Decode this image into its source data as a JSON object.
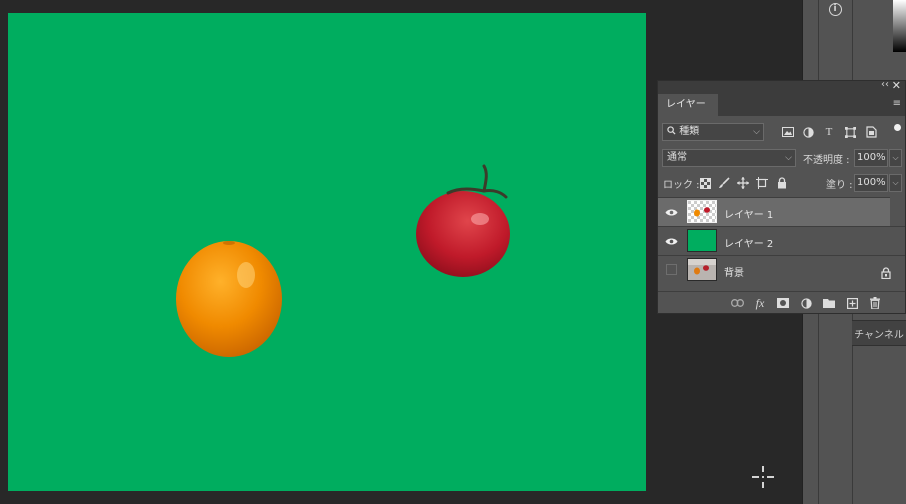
{
  "app": {
    "colors": {
      "canvas_bg": "#00ad5f",
      "workspace_bg": "#282828",
      "panel_bg": "#535353",
      "selected_row": "#6b6b6b"
    }
  },
  "dock": {
    "info_glyph": "i",
    "channel_tab_label": "チャンネル"
  },
  "layers_panel": {
    "tab_label": "レイヤー",
    "collapse_glyph": "‹‹",
    "close_glyph": "✕",
    "menu_glyph": "≡",
    "filter": {
      "selected": "種類",
      "icons": [
        "image-filter-icon",
        "adjustment-filter-icon",
        "type-filter-icon",
        "shape-filter-icon",
        "smart-object-filter-icon"
      ]
    },
    "blend_mode": "通常",
    "opacity_label": "不透明度 :",
    "opacity_value": "100%",
    "lock_label": "ロック :",
    "lock_icons": [
      "lock-transparent-icon",
      "lock-image-icon",
      "lock-position-icon",
      "lock-artboard-icon",
      "lock-all-icon"
    ],
    "fill_label": "塗り :",
    "fill_value": "100%",
    "layers": [
      {
        "name": "レイヤー 1",
        "visible": true,
        "selected": true,
        "thumb": "transparent-with-tomatoes",
        "locked": false
      },
      {
        "name": "レイヤー 2",
        "visible": true,
        "selected": false,
        "thumb": "solid-green",
        "locked": false
      },
      {
        "name": "背景",
        "visible": false,
        "selected": false,
        "thumb": "photo",
        "locked": true
      }
    ],
    "bottom_icons": [
      "link-layers-icon",
      "fx-icon",
      "add-mask-icon",
      "adjustment-layer-icon",
      "new-group-icon",
      "new-layer-icon",
      "trash-icon"
    ],
    "fx_glyph": "fx"
  }
}
